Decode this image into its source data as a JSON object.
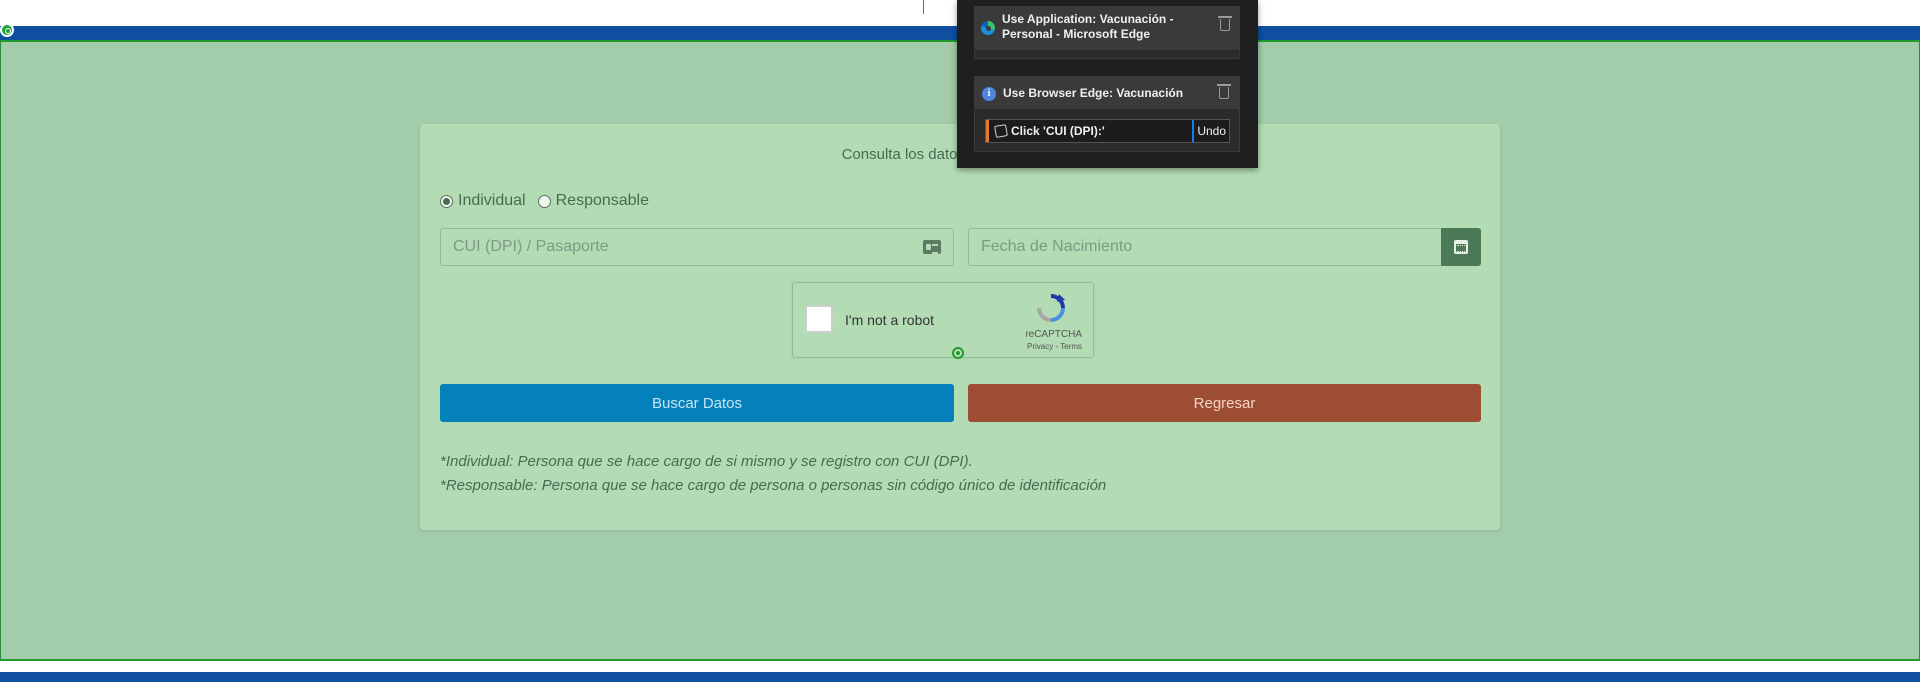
{
  "page": {
    "title": "Consulta los datos de vacunación q"
  },
  "form": {
    "radio_options": [
      {
        "label": "Individual",
        "checked": true
      },
      {
        "label": "Responsable",
        "checked": false
      }
    ],
    "cui_placeholder": "CUI (DPI) / Pasaporte",
    "fecha_placeholder": "Fecha de Nacimiento",
    "buscar_label": "Buscar Datos",
    "regresar_label": "Regresar"
  },
  "recaptcha": {
    "label": "I'm not a robot",
    "brand": "reCAPTCHA",
    "links": "Privacy - Terms"
  },
  "notes": [
    "*Individual: Persona que se hace cargo de si mismo y se registro con CUI (DPI).",
    "*Responsable: Persona que se hace cargo de persona o personas sin código único de identificación"
  ],
  "recorder": {
    "app_step": "Use Application: Vacunación - Personal - Microsoft Edge",
    "browser_step": "Use Browser Edge: Vacunación",
    "click_step": "Click 'CUI (DPI):'",
    "undo_label": "Undo"
  },
  "colors": {
    "page_background": "#a3ccaa",
    "card_background": "#b3dcb5",
    "buscar_button": "#0480bb",
    "regresar_button": "#9e4d35",
    "calendar_button": "#4d7a56",
    "header_blue": "#0e4fa0",
    "recorder_background": "#1f1f1f",
    "click_accent": "#e07a2e"
  },
  "icons": [
    "id-card-icon",
    "calendar-icon",
    "recaptcha-logo-icon",
    "edge-icon",
    "info-icon",
    "trash-icon",
    "click-icon",
    "target-icon"
  ]
}
